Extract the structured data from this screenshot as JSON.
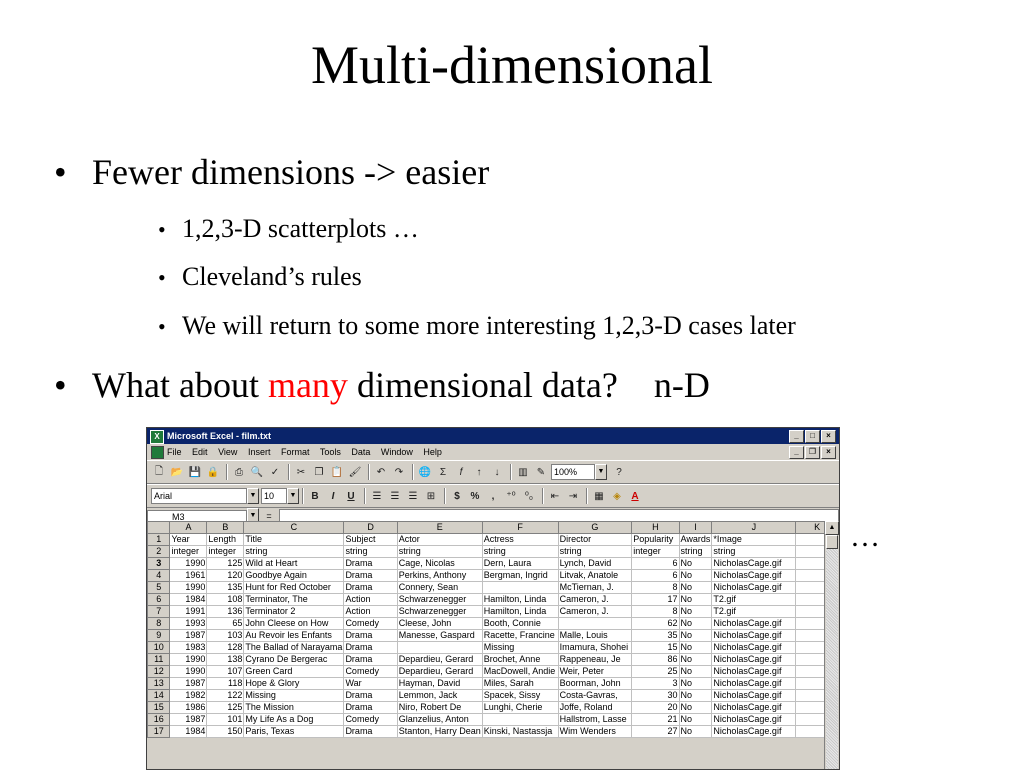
{
  "slide": {
    "title": "Multi-dimensional",
    "bullets": [
      {
        "text": "Fewer dimensions -> easier",
        "sub": [
          "1,2,3-D scatterplots …",
          "Cleveland’s rules",
          "We will return to some more interesting 1,2,3-D cases later"
        ]
      },
      {
        "pre": "What about ",
        "em": "many",
        "post": " dimensional data?    n-D"
      }
    ],
    "bullet_glyph": "•",
    "ellipsis": "…"
  },
  "excel": {
    "title": "Microsoft Excel - film.txt",
    "app_icon": "excel-icon",
    "window_buttons": [
      "_",
      "□",
      "×"
    ],
    "doc_buttons": [
      "_",
      "❐",
      "×"
    ],
    "menu": [
      "File",
      "Edit",
      "View",
      "Insert",
      "Format",
      "Tools",
      "Data",
      "Window",
      "Help"
    ],
    "toolbar_icons": [
      "new-icon",
      "open-icon",
      "save-icon",
      "permission-icon",
      "print-icon",
      "print-preview-icon",
      "spelling-icon",
      "cut-icon",
      "copy-icon",
      "paste-icon",
      "format-painter-icon",
      "undo-icon",
      "redo-icon",
      "hyperlink-icon",
      "autosum-icon",
      "function-icon",
      "sort-ascending-icon",
      "sort-descending-icon",
      "chart-wizard-icon",
      "drawing-icon"
    ],
    "zoom": "100%",
    "format_toolbar": {
      "font": "Arial",
      "size": "10",
      "bold": "B",
      "italic": "I",
      "underline": "U",
      "currency": "$",
      "percent": "%",
      "comma": ","
    },
    "name_box": "M3",
    "fx_label": "=",
    "formula": "",
    "columns": [
      "",
      "A",
      "B",
      "C",
      "D",
      "E",
      "F",
      "G",
      "H",
      "I",
      "J",
      "K"
    ],
    "selected_row": "3",
    "rows": [
      [
        "1",
        "Year",
        "Length",
        "Title",
        "Subject",
        "Actor",
        "Actress",
        "Director",
        "Popularity",
        "Awards",
        "*Image",
        ""
      ],
      [
        "2",
        "integer",
        "integer",
        "string",
        "string",
        "string",
        "string",
        "string",
        "integer",
        "string",
        "string",
        ""
      ],
      [
        "3",
        "1990",
        "125",
        "Wild at Heart",
        "Drama",
        "Cage, Nicolas",
        "Dern, Laura",
        "Lynch, David",
        "6",
        "No",
        "NicholasCage.gif",
        ""
      ],
      [
        "4",
        "1961",
        "120",
        "Goodbye Again",
        "Drama",
        "Perkins, Anthony",
        "Bergman, Ingrid",
        "Litvak, Anatole",
        "6",
        "No",
        "NicholasCage.gif",
        ""
      ],
      [
        "5",
        "1990",
        "135",
        "Hunt for Red October",
        "Drama",
        "Connery, Sean",
        "",
        "McTiernan, J.",
        "8",
        "No",
        "NicholasCage.gif",
        ""
      ],
      [
        "6",
        "1984",
        "108",
        "Terminator, The",
        "Action",
        "Schwarzenegger",
        "Hamilton, Linda",
        "Cameron, J.",
        "17",
        "No",
        "T2.gif",
        ""
      ],
      [
        "7",
        "1991",
        "136",
        "Terminator 2",
        "Action",
        "Schwarzenegger",
        "Hamilton, Linda",
        "Cameron, J.",
        "8",
        "No",
        "T2.gif",
        ""
      ],
      [
        "8",
        "1993",
        "65",
        "John Cleese on How",
        "Comedy",
        "Cleese, John",
        "Booth, Connie",
        "",
        "62",
        "No",
        "NicholasCage.gif",
        ""
      ],
      [
        "9",
        "1987",
        "103",
        "Au Revoir les Enfants",
        "Drama",
        "Manesse, Gaspard",
        "Racette, Francine",
        "Malle, Louis",
        "35",
        "No",
        "NicholasCage.gif",
        ""
      ],
      [
        "10",
        "1983",
        "128",
        "The Ballad of Narayama",
        "Drama",
        "",
        "Missing",
        "Imamura, Shohei",
        "15",
        "No",
        "NicholasCage.gif",
        ""
      ],
      [
        "11",
        "1990",
        "138",
        "Cyrano De Bergerac",
        "Drama",
        "Depardieu, Gerard",
        "Brochet, Anne",
        "Rappeneau, Je",
        "86",
        "No",
        "NicholasCage.gif",
        ""
      ],
      [
        "12",
        "1990",
        "107",
        "Green Card",
        "Comedy",
        "Depardieu, Gerard",
        "MacDowell, Andie",
        "Weir, Peter",
        "25",
        "No",
        "NicholasCage.gif",
        ""
      ],
      [
        "13",
        "1987",
        "118",
        "Hope & Glory",
        "War",
        "Hayman, David",
        "Miles, Sarah",
        "Boorman, John",
        "3",
        "No",
        "NicholasCage.gif",
        ""
      ],
      [
        "14",
        "1982",
        "122",
        "Missing",
        "Drama",
        "Lemmon, Jack",
        "Spacek, Sissy",
        "Costa-Gavras,",
        "30",
        "No",
        "NicholasCage.gif",
        ""
      ],
      [
        "15",
        "1986",
        "125",
        "The Mission",
        "Drama",
        "Niro, Robert De",
        "Lunghi, Cherie",
        "Joffe, Roland",
        "20",
        "No",
        "NicholasCage.gif",
        ""
      ],
      [
        "16",
        "1987",
        "101",
        "My Life As a Dog",
        "Comedy",
        "Glanzelius, Anton",
        "",
        "Hallstrom, Lasse",
        "21",
        "No",
        "NicholasCage.gif",
        ""
      ],
      [
        "17",
        "1984",
        "150",
        "Paris, Texas",
        "Drama",
        "Stanton, Harry Dean",
        "Kinski, Nastassja",
        "Wim Wenders",
        "27",
        "No",
        "NicholasCage.gif",
        ""
      ]
    ],
    "numeric_cols": [
      1,
      2,
      8
    ]
  }
}
